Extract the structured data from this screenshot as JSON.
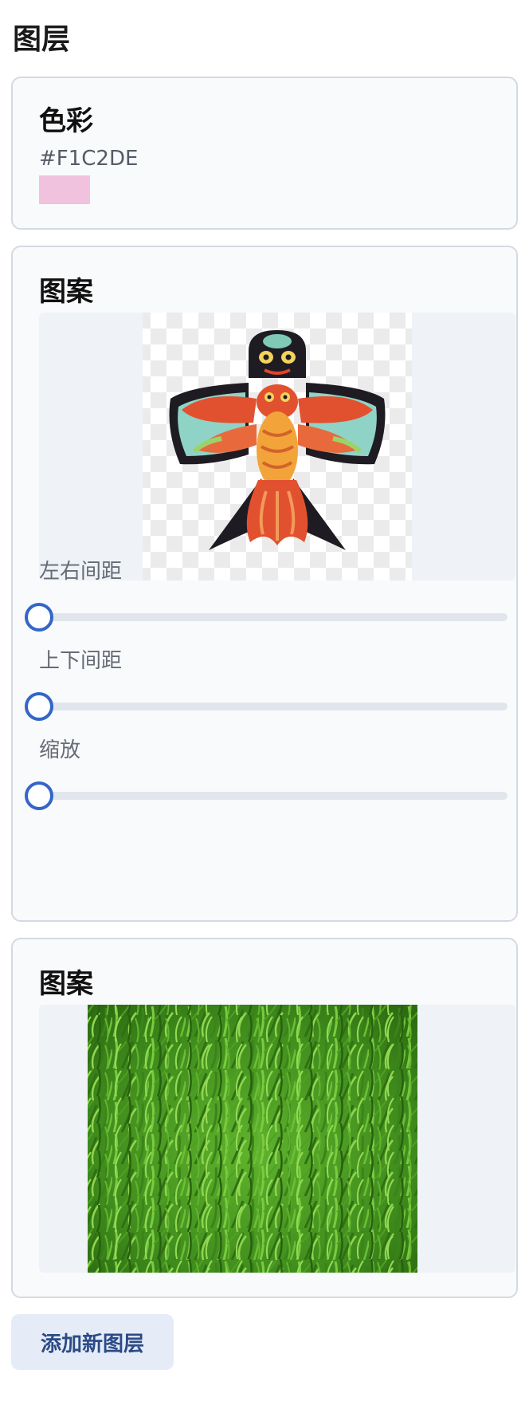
{
  "page": {
    "title": "图层"
  },
  "color_card": {
    "title": "色彩",
    "hex_label": "#F1C2DE",
    "swatch_color": "#F1C2DE"
  },
  "pattern_card_1": {
    "title": "图案",
    "image_icon": "swallow-kite-image",
    "sliders": [
      {
        "label": "左右间距",
        "value": 0
      },
      {
        "label": "上下间距",
        "value": 0
      },
      {
        "label": "缩放",
        "value": 0
      }
    ]
  },
  "pattern_card_2": {
    "title": "图案",
    "image_icon": "grass-texture-image"
  },
  "actions": {
    "add_layer": "添加新图层"
  },
  "colors": {
    "accent": "#3466C7",
    "card_background": "#F9FAFC",
    "button_background": "#E5ECF7"
  }
}
